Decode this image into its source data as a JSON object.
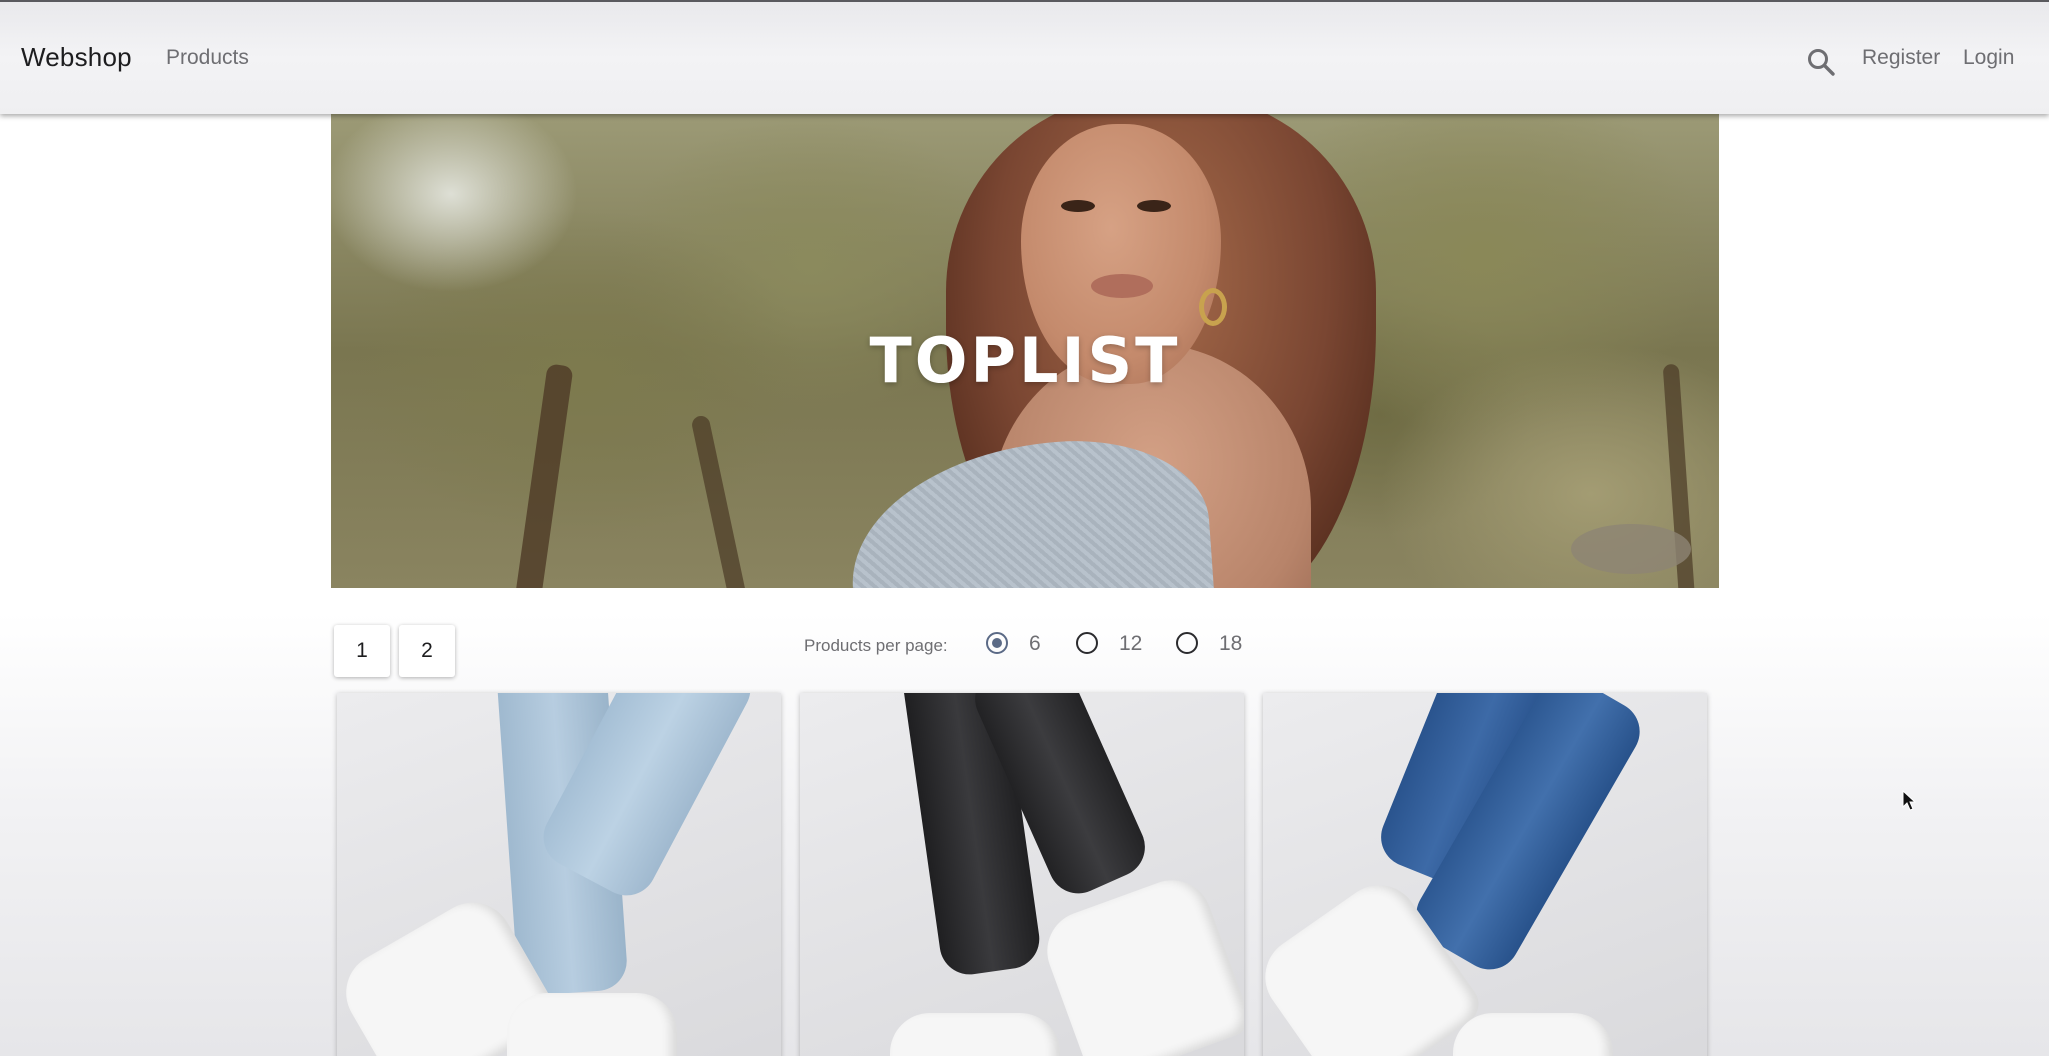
{
  "navbar": {
    "brand": "Webshop",
    "products_link": "Products",
    "search_icon": "search-icon",
    "register_link": "Register",
    "login_link": "Login"
  },
  "hero": {
    "title": "TOPLIST"
  },
  "pagination": {
    "pages": [
      "1",
      "2"
    ]
  },
  "per_page": {
    "label": "Products per page:",
    "options": [
      "6",
      "12",
      "18"
    ],
    "selected": "6",
    "accent_color": "#5b6a86"
  },
  "products": [
    {
      "image": "light-blue-jeans-white-sneakers"
    },
    {
      "image": "black-jeans-white-sneakers"
    },
    {
      "image": "blue-jeans-white-sneakers"
    }
  ]
}
